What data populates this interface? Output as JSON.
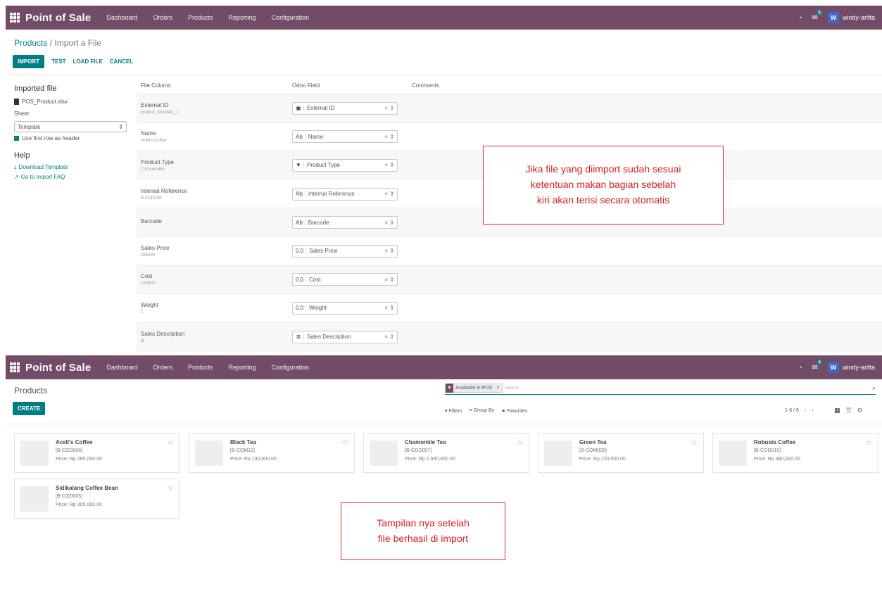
{
  "app": {
    "brand": "Point of Sale",
    "menu": [
      "Dashboard",
      "Orders",
      "Products",
      "Reporting",
      "Configuration"
    ],
    "user_initial": "W",
    "user_name": "windy-arifta",
    "chat_badge": "1"
  },
  "import_screen": {
    "breadcrumb_parent": "Products",
    "breadcrumb_sep": " / ",
    "breadcrumb_current": "Import a File",
    "buttons": {
      "import": "IMPORT",
      "test": "TEST",
      "load_file": "LOAD FILE",
      "cancel": "CANCEL"
    },
    "sidebar": {
      "imported_title": "Imported file",
      "filename": "POS_Product.xlsx",
      "sheet_label": "Sheet:",
      "sheet_value": "Template",
      "header_checkbox": "Use first row as header",
      "help_title": "Help",
      "download_template": "Download Template",
      "import_faq": "Go to Import FAQ"
    },
    "columns": {
      "file_column": "File Column",
      "odoo_field": "Odoo Field",
      "comments": "Comments"
    },
    "rows": [
      {
        "column": "External ID",
        "sample": "product_template_1",
        "icon": "▣",
        "field": "External ID"
      },
      {
        "column": "Name",
        "sample": "Acell's Coffee",
        "icon": "Ab",
        "field": "Name"
      },
      {
        "column": "Product Type",
        "sample": "Consumable",
        "icon": "▼",
        "field": "Product Type"
      },
      {
        "column": "Internal Reference",
        "sample": "B-COD006",
        "icon": "Ab",
        "field": "Internal Reference"
      },
      {
        "column": "Barcode",
        "sample": "",
        "icon": "Ab",
        "field": "Barcode"
      },
      {
        "column": "Sales Price",
        "sample": "285000",
        "icon": "0.0",
        "field": "Sales Price"
      },
      {
        "column": "Cost",
        "sample": "150000",
        "icon": "0.0",
        "field": "Cost"
      },
      {
        "column": "Weight",
        "sample": "1",
        "icon": "0.0",
        "field": "Weight"
      },
      {
        "column": "Sales Description",
        "sample": "tb",
        "icon": "≣",
        "field": "Sales Description"
      }
    ],
    "callout_lines": [
      "Jika file yang diimport sudah sesuai",
      "ketentuan makan bagian sebelah",
      "kiri akan terisi secara otomatis"
    ]
  },
  "products_screen": {
    "title": "Products",
    "create_label": "CREATE",
    "search_facet": "Available in POS",
    "search_placeholder": "Search...",
    "filters_label": "Filters",
    "group_by_label": "Group By",
    "favorites_label": "Favorites",
    "pager": "1-6 / 6",
    "products": [
      {
        "name": "Acell's Coffee",
        "ref": "[B-COD006]",
        "price": "Price: Rp 285,000.00"
      },
      {
        "name": "Black Tea",
        "ref": "[B-COM12]",
        "price": "Price: Rp 130,000.00"
      },
      {
        "name": "Chamomile Tea",
        "ref": "[B-COD007]",
        "price": "Price: Rp 1,500,000.00"
      },
      {
        "name": "Green Tea",
        "ref": "[B-COM009]",
        "price": "Price: Rp 120,000.00"
      },
      {
        "name": "Robusta Coffee",
        "ref": "[B-COD010]",
        "price": "Price: Rp 480,000.00"
      },
      {
        "name": "Sidikalang Coffee Bean",
        "ref": "[B-COD005]",
        "price": "Price: Rp 305,000.00"
      }
    ],
    "callout_lines": [
      "Tampilan nya setelah",
      "file berhasil di import"
    ]
  },
  "colors": {
    "navbar": "#714b67",
    "primary": "#017e84",
    "callout": "#d32f2f"
  }
}
